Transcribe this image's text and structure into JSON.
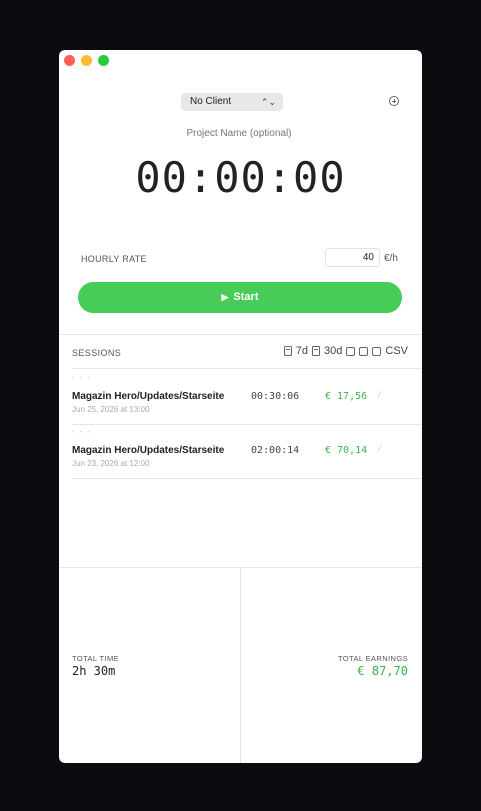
{
  "top": {
    "client_select": "No Client",
    "project_placeholder": "Project Name (optional)",
    "timer": "00:00:00"
  },
  "rate": {
    "label": "HOURLY RATE",
    "value": "40",
    "unit": "€/h"
  },
  "start_label": "Start",
  "sessions": {
    "label": "SESSIONS",
    "filter_7d": "7d",
    "filter_30d": "30d",
    "csv": "CSV",
    "rows": [
      {
        "name": "Magazin Hero/Updates/Starseite",
        "date": "Jun 25, 2026 at 13:00",
        "duration": "00:30:06",
        "earnings": "€ 17,56"
      },
      {
        "name": "Magazin Hero/Updates/Starseite",
        "date": "Jun 23, 2026 at 12:00",
        "duration": "02:00:14",
        "earnings": "€ 70,14"
      }
    ]
  },
  "totals": {
    "time_label": "TOTAL TIME",
    "time_value": "2h 30m",
    "earnings_label": "TOTAL EARNINGS",
    "earnings_value": "€ 87,70"
  },
  "colors": {
    "accent_green": "#47cb59",
    "earnings_green": "#3bb24b"
  }
}
